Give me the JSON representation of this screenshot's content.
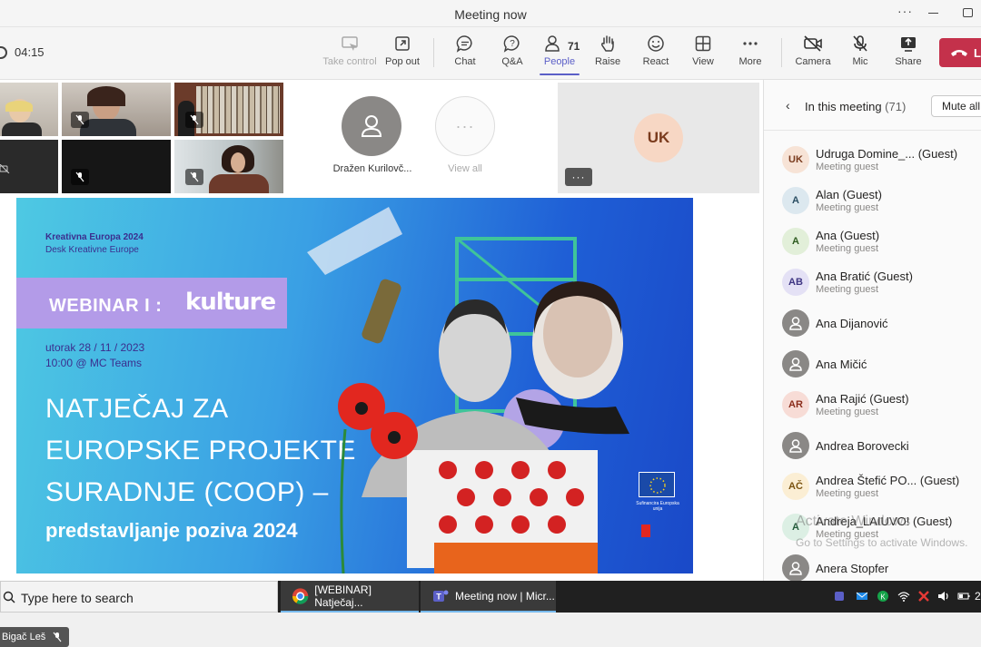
{
  "window": {
    "title": "Meeting now"
  },
  "toolbar": {
    "timer": "04:15",
    "buttons": {
      "take_control": "Take control",
      "pop_out": "Pop out",
      "chat": "Chat",
      "qa": "Q&A",
      "people": "People",
      "people_count": "71",
      "raise": "Raise",
      "react": "React",
      "view": "View",
      "more": "More",
      "camera": "Camera",
      "mic": "Mic",
      "share": "Share",
      "leave": "L"
    }
  },
  "stage": {
    "featured_participant": "Dražen Kurilovč...",
    "view_all": "View all",
    "uk_tile_initials": "UK",
    "name_tag": "Bigač Leš"
  },
  "slide": {
    "kicker_line1": "Kreativna Europa 2024",
    "kicker_line2": "Desk Kreativne Europe",
    "webinar_label": "WEBINAR I :",
    "logo_text": "kulture",
    "date_line1": "utorak 28 / 11 / 2023",
    "date_line2": "10:00 @ MC Teams",
    "headline": [
      "NATJEČAJ ZA",
      "EUROPSKE PROJEKTE",
      "SURADNJE (COOP) –"
    ],
    "subheadline": "predstavljanje poziva 2024",
    "eu_label": "Sufinancira Europska unija"
  },
  "panel": {
    "title": "In this meeting",
    "count": "(71)",
    "mute_all": "Mute all",
    "participants": [
      {
        "initials": "UK",
        "name": "Udruga Domine_... (Guest)",
        "sub": "Meeting guest",
        "bg": "#f7e3d6",
        "fg": "#7a3b1d"
      },
      {
        "initials": "A",
        "name": "Alan (Guest)",
        "sub": "Meeting guest",
        "bg": "#dce8ef",
        "fg": "#2a4e63"
      },
      {
        "initials": "A",
        "name": "Ana (Guest)",
        "sub": "Meeting guest",
        "bg": "#e2efd9",
        "fg": "#2e5b1f"
      },
      {
        "initials": "AB",
        "name": "Ana Bratić (Guest)",
        "sub": "Meeting guest",
        "bg": "#e4e1f5",
        "fg": "#3e3582"
      },
      {
        "initials": "",
        "name": "Ana Dijanović",
        "sub": "",
        "bg": "#8a8886",
        "fg": "#ffffff"
      },
      {
        "initials": "",
        "name": "Ana Mičić",
        "sub": "",
        "bg": "#8a8886",
        "fg": "#ffffff"
      },
      {
        "initials": "AR",
        "name": "Ana Rajić (Guest)",
        "sub": "Meeting guest",
        "bg": "#f7dcd6",
        "fg": "#8a2c1a"
      },
      {
        "initials": "",
        "name": "Andrea Borovecki",
        "sub": "",
        "bg": "#8a8886",
        "fg": "#ffffff"
      },
      {
        "initials": "AČ",
        "name": "Andrea Štefić PO... (Guest)",
        "sub": "Meeting guest",
        "bg": "#fbeed4",
        "fg": "#7a5311"
      },
      {
        "initials": "A",
        "name": "Andreja_LAIUVO! (Guest)",
        "sub": "Meeting guest",
        "bg": "#dcefe4",
        "fg": "#245b3b"
      },
      {
        "initials": "",
        "name": "Anera Stopfer",
        "sub": "",
        "bg": "#8a8886",
        "fg": "#ffffff"
      }
    ],
    "watermark_line1": "Activate Windows",
    "watermark_line2": "Go to Settings to activate Windows."
  },
  "taskbar": {
    "search_placeholder": "Type here to search",
    "apps": [
      {
        "label": "[WEBINAR] Natječaj...",
        "icon": "chrome-icon"
      },
      {
        "label": "Meeting now | Micr...",
        "icon": "teams-icon"
      }
    ],
    "clock_fragment": "2"
  },
  "colors": {
    "accent": "#5b5fc7",
    "leave": "#c4314b"
  }
}
